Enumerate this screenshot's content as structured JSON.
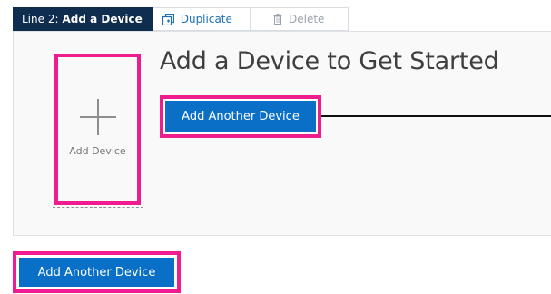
{
  "tabs": {
    "active": {
      "prefix": "Line 2:",
      "name": "Add a Device"
    },
    "duplicate_label": "Duplicate",
    "delete_label": "Delete"
  },
  "panel": {
    "title": "Add a Device to Get Started",
    "add_card_label": "Add Device",
    "inline_button_label": "Add Another Device"
  },
  "footer": {
    "button_label": "Add Another Device"
  },
  "icons": {
    "duplicate": "duplicate-icon",
    "delete": "trash-icon",
    "add": "plus-icon"
  },
  "colors": {
    "tab_active_bg": "#0f2d4f",
    "primary_button": "#0a6fc7",
    "link": "#1c6fb8",
    "highlight": "#ee1c8e"
  }
}
